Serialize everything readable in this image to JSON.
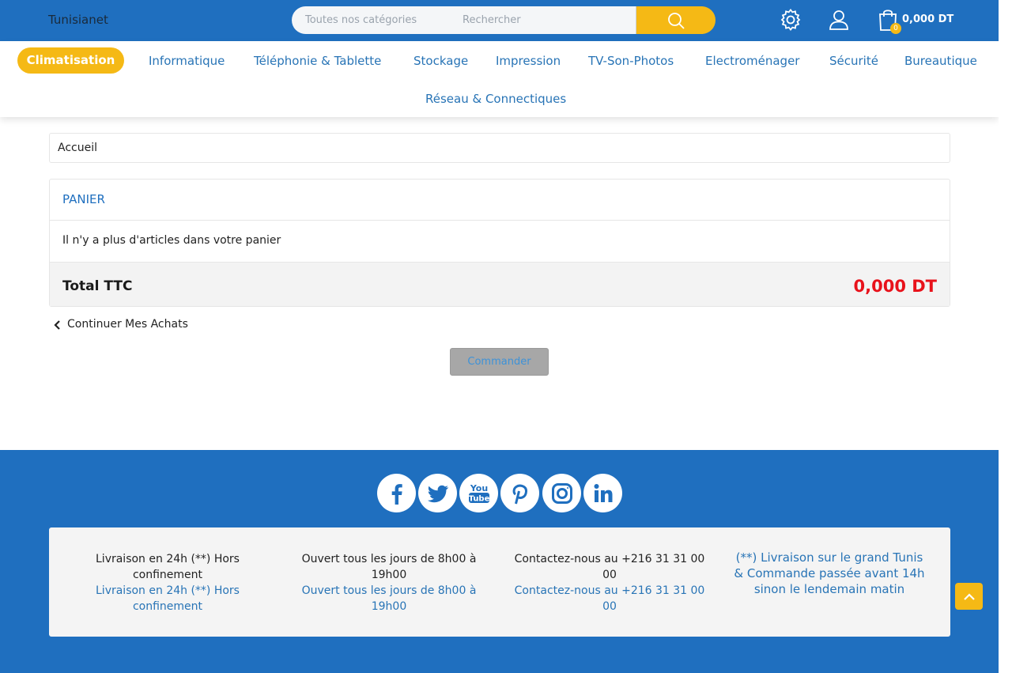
{
  "header": {
    "brand": "Tunisianet",
    "search": {
      "category_label": "Toutes nos catégories",
      "placeholder": "Rechercher"
    },
    "cart": {
      "count": "0",
      "total": "0,000 DT"
    },
    "icons": [
      "settings-gear-icon",
      "user-icon",
      "shopping-bag-icon",
      "search-icon"
    ]
  },
  "catnav": {
    "active": "Climatisation",
    "items": [
      "Informatique",
      "Téléphonie & Tablette",
      "Stockage",
      "Impression",
      "TV-Son-Photos",
      "Electroménager",
      "Sécurité",
      "Bureautique",
      "Réseau & Connectiques"
    ]
  },
  "breadcrumb": "Accueil",
  "cart": {
    "title": "PANIER",
    "empty_message": "Il n'y a plus d'articles dans votre panier",
    "total_label": "Total TTC",
    "total_value": "0,000 DT",
    "continue_label": "Continuer Mes Achats",
    "order_button": "Commander"
  },
  "footer": {
    "social": [
      "facebook-icon",
      "twitter-icon",
      "youtube-icon",
      "pinterest-icon",
      "instagram-icon",
      "linkedin-icon"
    ],
    "info": [
      {
        "dark": "Livraison en 24h (**) Hors confinement",
        "blue": "Livraison en 24h (**) Hors confinement"
      },
      {
        "dark": "Ouvert tous les jours de 8h00 à 19h00",
        "blue": "Ouvert tous les jours de 8h00 à 19h00"
      },
      {
        "dark": "Contactez-nous au +216 31 31 00 00",
        "blue": "Contactez-nous au +216 31 31 00 00"
      }
    ],
    "note": "(**) Livraison sur le grand Tunis & Commande passée avant 14h sinon le lendemain matin"
  },
  "colors": {
    "primary_blue": "#1f6fbf",
    "accent_yellow": "#f5b915",
    "price_red": "#e8121b"
  }
}
